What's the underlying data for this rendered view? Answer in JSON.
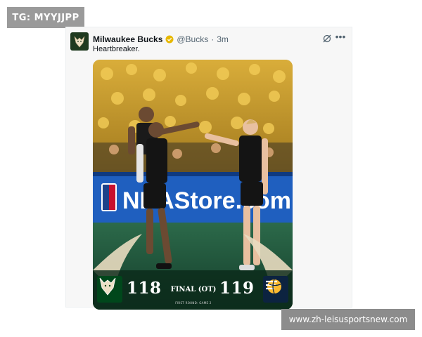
{
  "watermarks": {
    "top_left": "TG: MYYJJPP",
    "bottom_right": "www.zh-leisusportsnew.com"
  },
  "tweet": {
    "author_name": "Milwaukee Bucks",
    "verified_badge": "verified-badge-icon",
    "handle": "@Bucks",
    "separator": "·",
    "time": "3m",
    "text": "Heartbreaker.",
    "actions": [
      "grok-icon",
      "more-icon"
    ]
  },
  "media": {
    "arena_signage": "NBAStore.com",
    "scoreboard": {
      "home_team_logo": "bucks-logo",
      "home_score": "118",
      "status": "FINAL (OT)",
      "away_score": "119",
      "away_team_logo": "pacers-logo",
      "subtitle": "FIRST ROUND: GAME 2"
    }
  },
  "colors": {
    "bucks_green": "#00471b",
    "crowd_yellow": "#e8b73a",
    "pacers_navy": "#0c2340",
    "pacers_gold": "#fdbb30",
    "signage_blue": "#1f5fbf"
  }
}
